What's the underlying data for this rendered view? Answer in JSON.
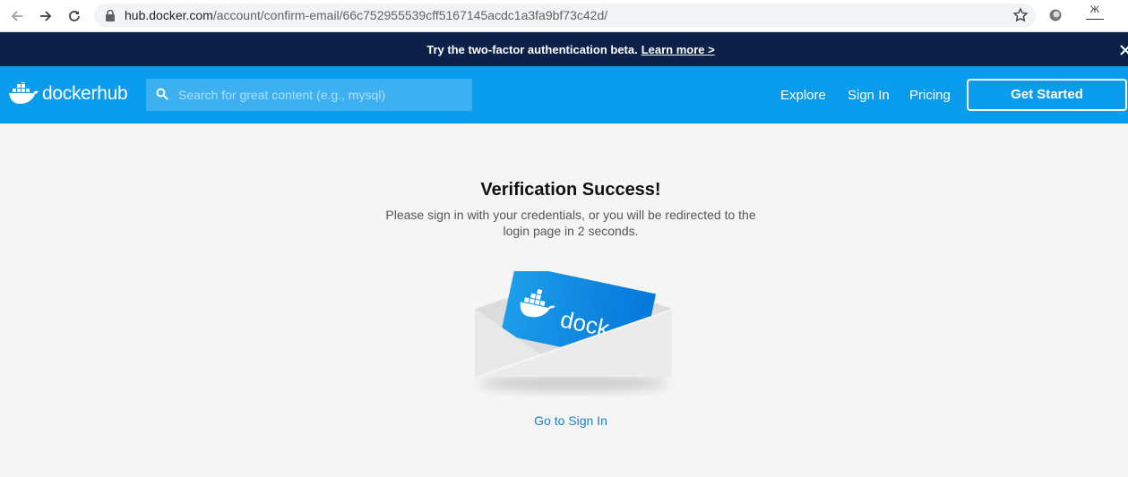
{
  "browser": {
    "url_domain": "hub.docker.com",
    "url_path": "/account/confirm-email/66c752955539cff5167145acdc1a3fa9bf73c42d/",
    "extension_label": "Ж"
  },
  "banner": {
    "text": "Try the two-factor authentication beta.",
    "link": "Learn more >"
  },
  "header": {
    "logo_word1": "docker",
    "logo_word2": "hub",
    "search_placeholder": "Search for great content (e.g., mysql)",
    "nav": {
      "explore": "Explore",
      "signin": "Sign In",
      "pricing": "Pricing",
      "get_started": "Get Started"
    }
  },
  "main": {
    "title": "Verification Success!",
    "message": "Please sign in with your credentials, or you will be redirected to the login page in 2 seconds.",
    "card_text": "dock",
    "link": "Go to Sign In"
  },
  "colors": {
    "brand_blue": "#099cec",
    "banner_navy": "#0b214a",
    "link_blue": "#1a7fc9"
  }
}
